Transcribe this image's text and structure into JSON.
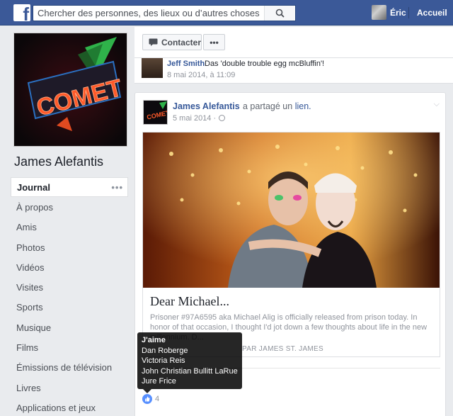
{
  "topbar": {
    "logo_letter": "f",
    "search_placeholder": "Chercher des personnes, des lieux ou d’autres choses",
    "user_name": "Éric",
    "home_label": "Accueil"
  },
  "profile": {
    "name": "James Alefantis",
    "cover_sign_text": "COMET"
  },
  "nav": {
    "items": [
      {
        "label": "Journal"
      },
      {
        "label": "À propos"
      },
      {
        "label": "Amis"
      },
      {
        "label": "Photos"
      },
      {
        "label": "Vidéos"
      },
      {
        "label": "Visites"
      },
      {
        "label": "Sports"
      },
      {
        "label": "Musique"
      },
      {
        "label": "Films"
      },
      {
        "label": "Émissions de télévision"
      },
      {
        "label": "Livres"
      },
      {
        "label": "Applications et jeux"
      }
    ],
    "more_dots": "•••"
  },
  "actions": {
    "contact_label": "Contacter",
    "more_label": "•••"
  },
  "prev_story": {
    "author": "Jeff Smith",
    "text": "Das 'double trouble egg mcBluffin'!",
    "date": "8 mai 2014, à 11:09"
  },
  "post": {
    "author": "James Alefantis",
    "shared_text": "a partagé un",
    "shared_link": "lien.",
    "date": "5 mai 2014 ·",
    "link_title": "Dear Michael...",
    "link_desc": "Prisoner #97A6595 aka Michael Alig is officially released from prison today. In honor of that occasion, I thought I'd jot down a few thoughts about life in the new millennium. D...",
    "link_source": "PAR JAMES ST. JAMES",
    "like_count": "4"
  },
  "tooltip": {
    "title": "J'aime",
    "names": [
      "Dan Roberge",
      "Victoria Reis",
      "John Christian Bullitt LaRue",
      "Jure Frice"
    ]
  },
  "colors": {
    "brand": "#3b5998",
    "link": "#365899",
    "like_blue": "#5890ff"
  }
}
